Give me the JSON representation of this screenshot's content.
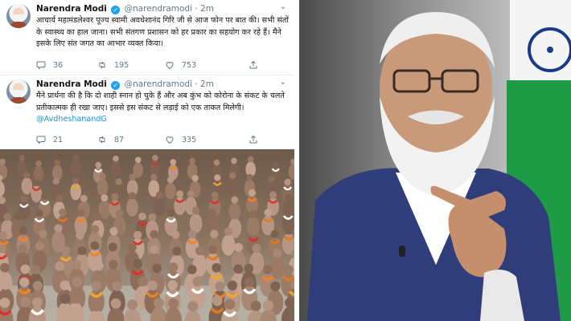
{
  "tweets": [
    {
      "name": "Narendra Modi",
      "handle": "@narendramodi",
      "dot": "·",
      "time": "2m",
      "text": "आचार्य महामंडलेश्वर पूज्य स्वामी अवधेशानंद गिरि जी से आज फोन पर बात की। सभी संतों के स्वास्थ्य का हाल जाना। सभी संतगण प्रशासन को हर प्रकार का सहयोग कर रहे हैं। मैंने इसके लिए संत जगत का आभार व्यक्त किया।",
      "mention": "",
      "replies": "36",
      "retweets": "195",
      "likes": "753"
    },
    {
      "name": "Narendra Modi",
      "handle": "@narendramodi",
      "dot": "·",
      "time": "2m",
      "text": "मैंने प्रार्थना की है कि दो शाही स्नान हो चुके हैं और अब कुंभ को कोरोना के संकट के चलते प्रतीकात्मक ही रखा जाए। इससे इस संकट से लड़ाई को एक ताकत मिलेगी।",
      "mention": "@AvdheshanandG",
      "replies": "21",
      "retweets": "87",
      "likes": "335"
    }
  ],
  "icons": {
    "verified": "verified-badge-icon",
    "more": "chevron-down-icon",
    "reply": "reply-icon",
    "retweet": "retweet-icon",
    "like": "heart-icon",
    "share": "share-icon"
  },
  "colors": {
    "accent": "#1da1f2",
    "link": "#1b95e0",
    "muted": "#657786",
    "text": "#14171a",
    "saffron": "#f58220"
  }
}
